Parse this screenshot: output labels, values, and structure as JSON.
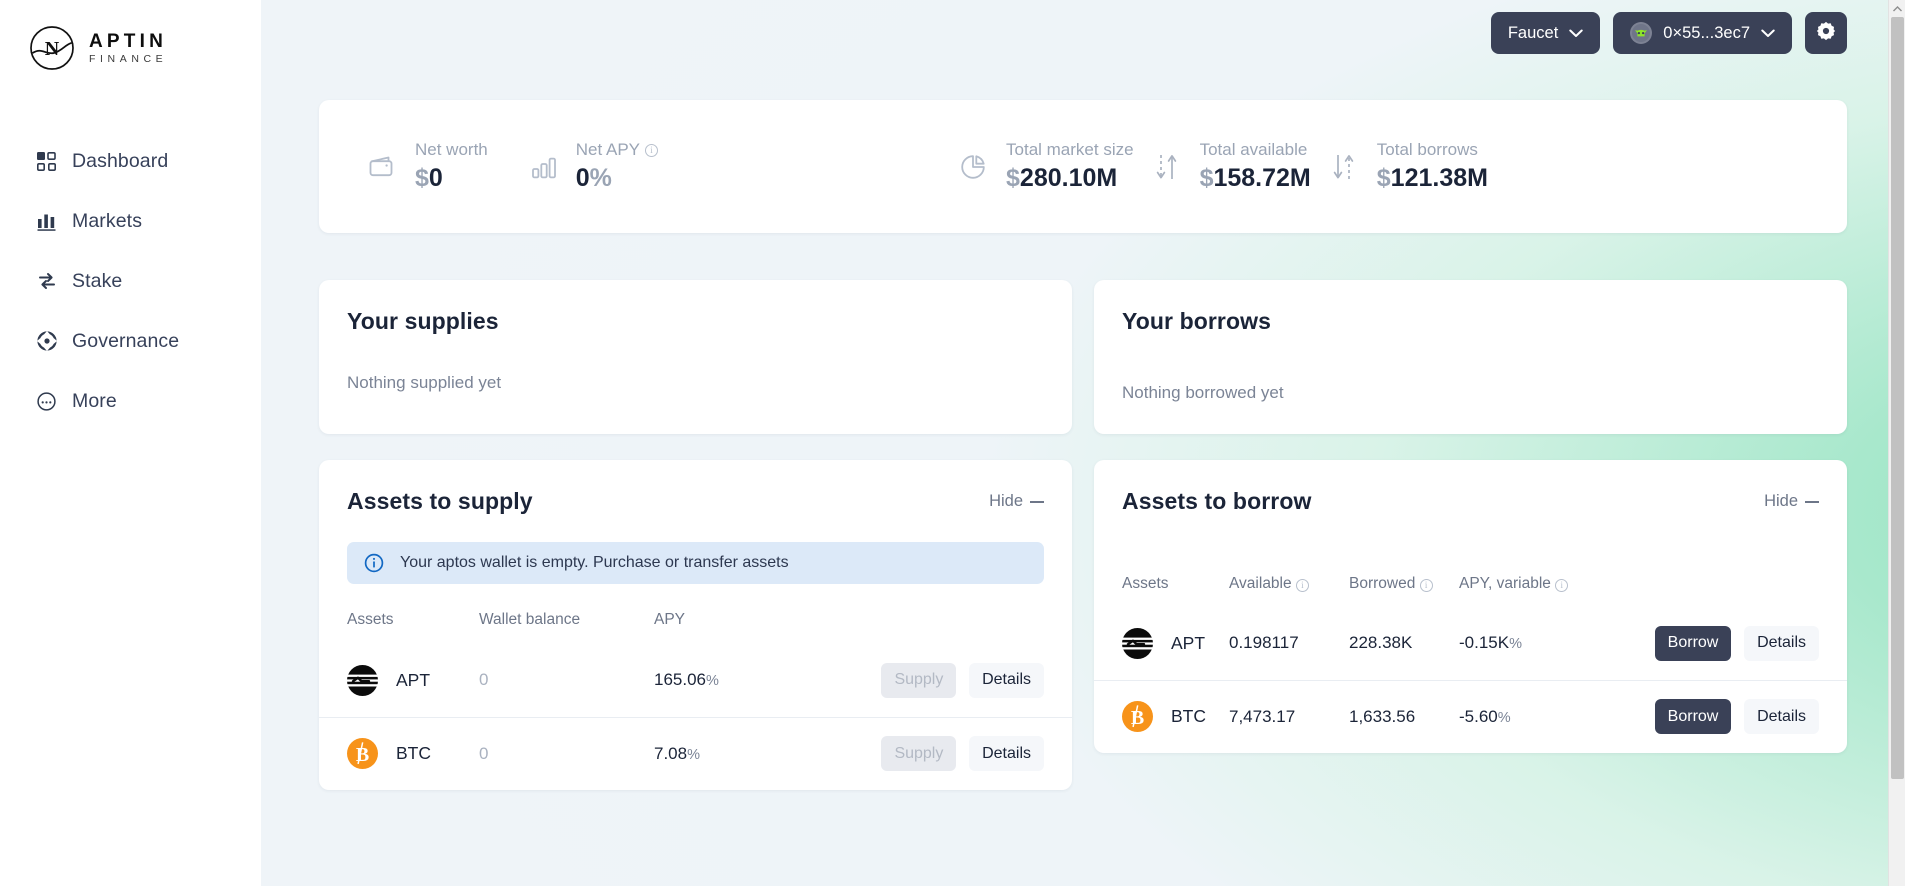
{
  "brand": {
    "name": "APTIN",
    "tagline": "FINANCE",
    "logo_icon": "aptin-logo-icon"
  },
  "sidebar": {
    "items": [
      {
        "label": "Dashboard",
        "icon": "grid-icon",
        "active": true
      },
      {
        "label": "Markets",
        "icon": "bar-chart-icon",
        "active": false
      },
      {
        "label": "Stake",
        "icon": "swap-icon",
        "active": false
      },
      {
        "label": "Governance",
        "icon": "compass-icon",
        "active": false
      },
      {
        "label": "More",
        "icon": "ellipsis-circle-icon",
        "active": false
      }
    ]
  },
  "topbar": {
    "faucet_label": "Faucet",
    "faucet_chevron": "chevron-down-icon",
    "wallet_address": "0×55...3ec7",
    "wallet_avatar_icon": "pontem-wallet-icon",
    "wallet_chevron": "chevron-down-icon",
    "settings_icon": "gear-icon"
  },
  "stats": [
    {
      "label": "Net worth",
      "icon": "wallet-icon",
      "prefix": "$",
      "value": "0",
      "suffix": ""
    },
    {
      "label": "Net APY",
      "icon": "bars-icon",
      "prefix": "",
      "value": "0",
      "suffix": "%",
      "info": true
    },
    {
      "label": "Total market size",
      "icon": "pie-chart-icon",
      "prefix": "$",
      "value": "280.10M",
      "suffix": ""
    },
    {
      "label": "Total available",
      "icon": "",
      "prefix": "$",
      "value": "158.72M",
      "suffix": ""
    },
    {
      "label": "Total borrows",
      "icon": "",
      "prefix": "$",
      "value": "121.38M",
      "suffix": ""
    }
  ],
  "your_supplies": {
    "title": "Your supplies",
    "empty_text": "Nothing supplied yet"
  },
  "your_borrows": {
    "title": "Your borrows",
    "empty_text": "Nothing borrowed yet"
  },
  "assets_to_supply": {
    "title": "Assets to supply",
    "hide_label": "Hide",
    "banner": {
      "icon": "info-circle-icon",
      "text": "Your aptos wallet is empty. Purchase or transfer assets"
    },
    "columns": [
      "Assets",
      "Wallet balance",
      "APY"
    ],
    "rows": [
      {
        "asset": "APT",
        "icon": "aptos-coin-icon",
        "wallet_balance": "0",
        "apy": "165.06",
        "apy_unit": "%",
        "action_label": "Supply",
        "action_disabled": true,
        "details_label": "Details"
      },
      {
        "asset": "BTC",
        "icon": "bitcoin-coin-icon",
        "wallet_balance": "0",
        "apy": "7.08",
        "apy_unit": "%",
        "action_label": "Supply",
        "action_disabled": true,
        "details_label": "Details"
      }
    ]
  },
  "assets_to_borrow": {
    "title": "Assets to borrow",
    "hide_label": "Hide",
    "columns": [
      "Assets",
      "Available",
      "Borrowed",
      "APY, variable"
    ],
    "rows": [
      {
        "asset": "APT",
        "icon": "aptos-coin-icon",
        "available": "0.198117",
        "borrowed": "228.38K",
        "apy": "-0.15K",
        "apy_unit": "%",
        "action_label": "Borrow",
        "details_label": "Details"
      },
      {
        "asset": "BTC",
        "icon": "bitcoin-coin-icon",
        "available": "7,473.17",
        "borrowed": "1,633.56",
        "apy": "-5.60",
        "apy_unit": "%",
        "action_label": "Borrow",
        "details_label": "Details"
      }
    ]
  },
  "colors": {
    "dark": "#3a4157",
    "text": "#1b2438",
    "muted": "#9aa4b4",
    "bg": "#eff4f8",
    "accent_green": "#8fe0bd",
    "banner_bg": "#dce9f8",
    "banner_icon": "#1268c3",
    "btc_orange": "#f7931a",
    "wallet_green": "#8ee62a"
  }
}
